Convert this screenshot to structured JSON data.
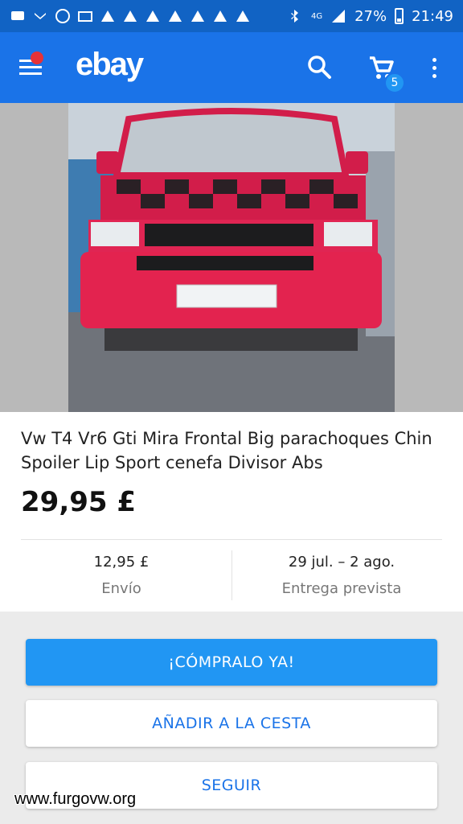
{
  "status_bar": {
    "signal_label": "4G",
    "battery": "27%",
    "time": "21:49"
  },
  "app_bar": {
    "logo": "ebay",
    "cart_count": "5"
  },
  "listing": {
    "title": "Vw T4 Vr6 Gti Mira Frontal Big parachoques Chin Spoiler Lip Sport cenefa Divisor Abs",
    "price": "29,95 £",
    "shipping": {
      "value": "12,95 £",
      "label": "Envío"
    },
    "delivery": {
      "value": "29 jul. – 2 ago.",
      "label": "Entrega prevista"
    }
  },
  "actions": {
    "buy_now": "¡CÓMPRALO YA!",
    "add_to_cart": "AÑADIR A LA CESTA",
    "watch": "SEGUIR"
  },
  "watermark": "www.furgovw.org",
  "colors": {
    "status_bar": "#1163c4",
    "app_bar": "#1a73e8",
    "primary_button": "#2196f3",
    "menu_notification": "#e53238"
  },
  "icons": [
    "menu-icon",
    "search-icon",
    "cart-icon",
    "more-vert-icon",
    "bluetooth-icon",
    "wifi-icon",
    "signal-icon",
    "battery-icon"
  ]
}
